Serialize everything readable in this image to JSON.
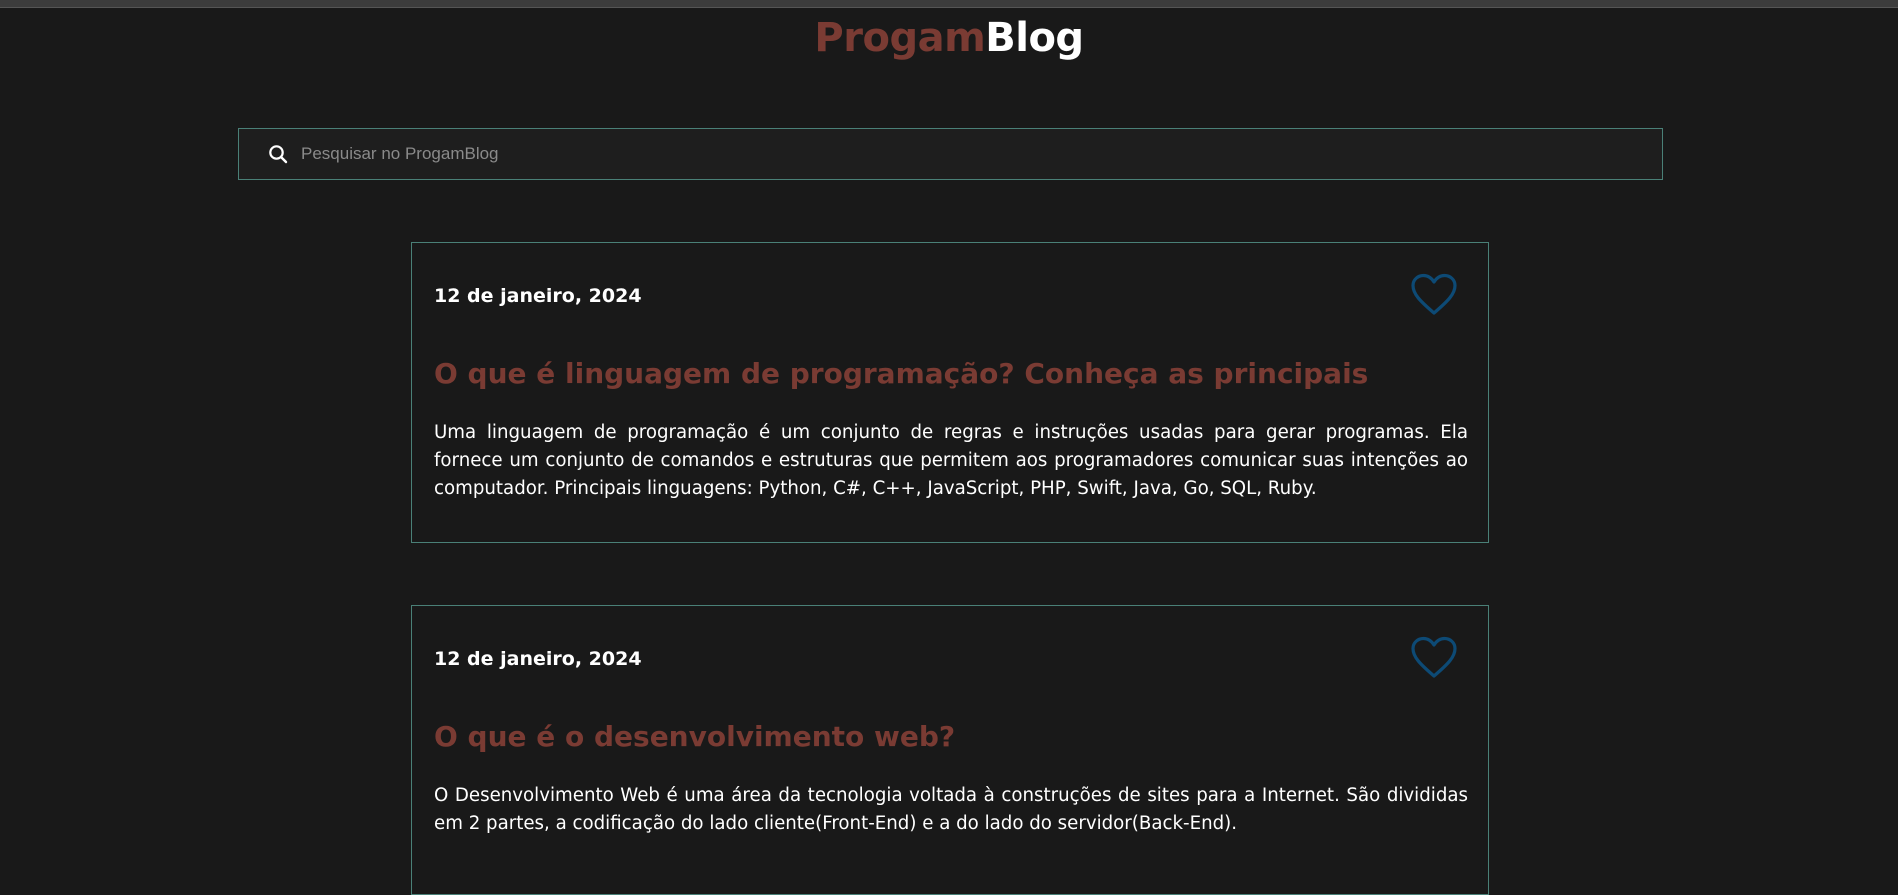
{
  "header": {
    "logo_part1": "Progam",
    "logo_part2": "Blog",
    "brand_color": "#7a3b33"
  },
  "search": {
    "icon": "search-icon",
    "placeholder": "Pesquisar no ProgamBlog",
    "value": ""
  },
  "posts": [
    {
      "date": "12 de janeiro, 2024",
      "title": "O que é linguagem de programação? Conheça as principais",
      "body": "Uma linguagem de programação é um conjunto de regras e instruções usadas para gerar programas. Ela fornece um conjunto de comandos e estruturas que permitem aos programadores comunicar suas intenções ao computador. Principais linguagens: Python, C#, C++, JavaScript, PHP, Swift, Java, Go, SQL, Ruby.",
      "like_icon": "heart-icon"
    },
    {
      "date": "12 de janeiro, 2024",
      "title": "O que é o desenvolvimento web?",
      "body": "O Desenvolvimento Web é uma área da tecnologia voltada à construções de sites para a Internet. São divididas em 2 partes, a codificação do lado cliente(Front-End) e a do lado do servidor(Back-End).",
      "like_icon": "heart-icon"
    }
  ],
  "colors": {
    "background": "#191919",
    "card_border": "#4a8077",
    "heart": "#0d4a75",
    "text": "#ffffff"
  }
}
